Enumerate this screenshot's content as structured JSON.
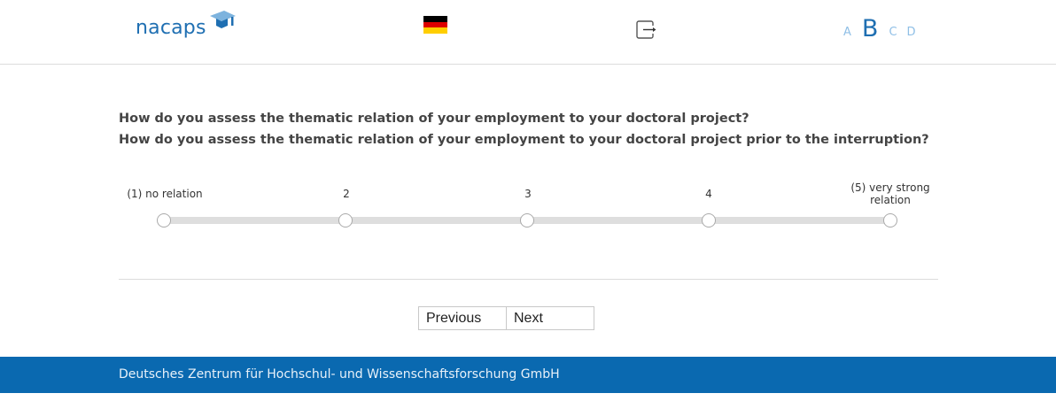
{
  "header": {
    "logo_text": "nacaps",
    "language_flag": "germany-flag",
    "logout_icon": "logout-icon",
    "font_sizes": [
      "A",
      "B",
      "C",
      "D"
    ],
    "active_font_size": "B"
  },
  "question": {
    "line1": "How do you assess the thematic relation of your employment to your doctoral project?",
    "line2": "How do you assess the thematic relation of your employment to your doctoral project prior to the interruption?"
  },
  "scale": {
    "labels": [
      "(1) no relation",
      "2",
      "3",
      "4",
      "(5) very strong relation"
    ],
    "selected": null
  },
  "nav": {
    "previous": "Previous",
    "next": "Next"
  },
  "footer": {
    "text": "Deutsches Zentrum für Hochschul- und Wissenschaftsforschung GmbH"
  },
  "colors": {
    "brand_blue": "#1f6fb2",
    "footer_blue": "#0a69b0",
    "font_size_inactive": "#8fbfe6"
  }
}
